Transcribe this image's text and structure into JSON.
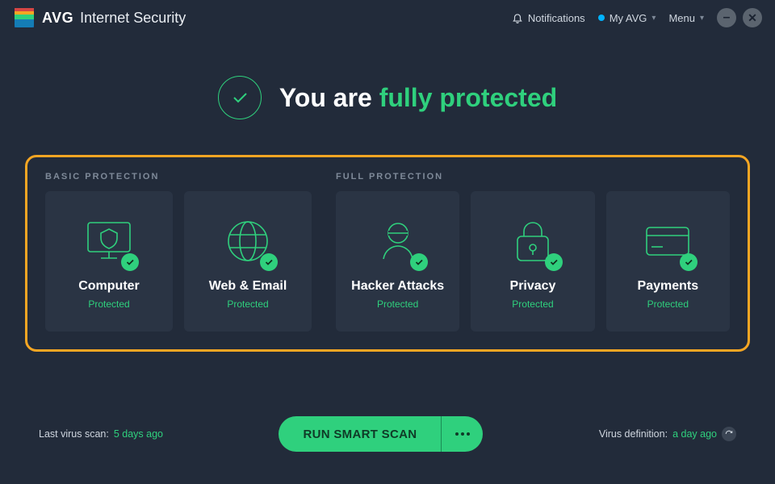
{
  "header": {
    "brand": "AVG",
    "suffix": "Internet Security",
    "notifications": "Notifications",
    "my_avg": "My AVG",
    "menu": "Menu"
  },
  "status": {
    "prefix": "You are ",
    "emph": "fully protected"
  },
  "sections": {
    "basic_label": "BASIC PROTECTION",
    "full_label": "FULL PROTECTION"
  },
  "tiles": {
    "computer": {
      "title": "Computer",
      "status": "Protected"
    },
    "web": {
      "title": "Web & Email",
      "status": "Protected"
    },
    "hacker": {
      "title": "Hacker Attacks",
      "status": "Protected"
    },
    "privacy": {
      "title": "Privacy",
      "status": "Protected"
    },
    "payments": {
      "title": "Payments",
      "status": "Protected"
    }
  },
  "footer": {
    "last_scan_label": "Last virus scan: ",
    "last_scan_value": "5 days ago",
    "scan_button": "RUN SMART SCAN",
    "defs_label": "Virus definition: ",
    "defs_value": "a day ago"
  },
  "colors": {
    "accent": "#2fd07d",
    "highlight": "#f6a623",
    "bg": "#222b3a",
    "tile": "#2a3444"
  }
}
